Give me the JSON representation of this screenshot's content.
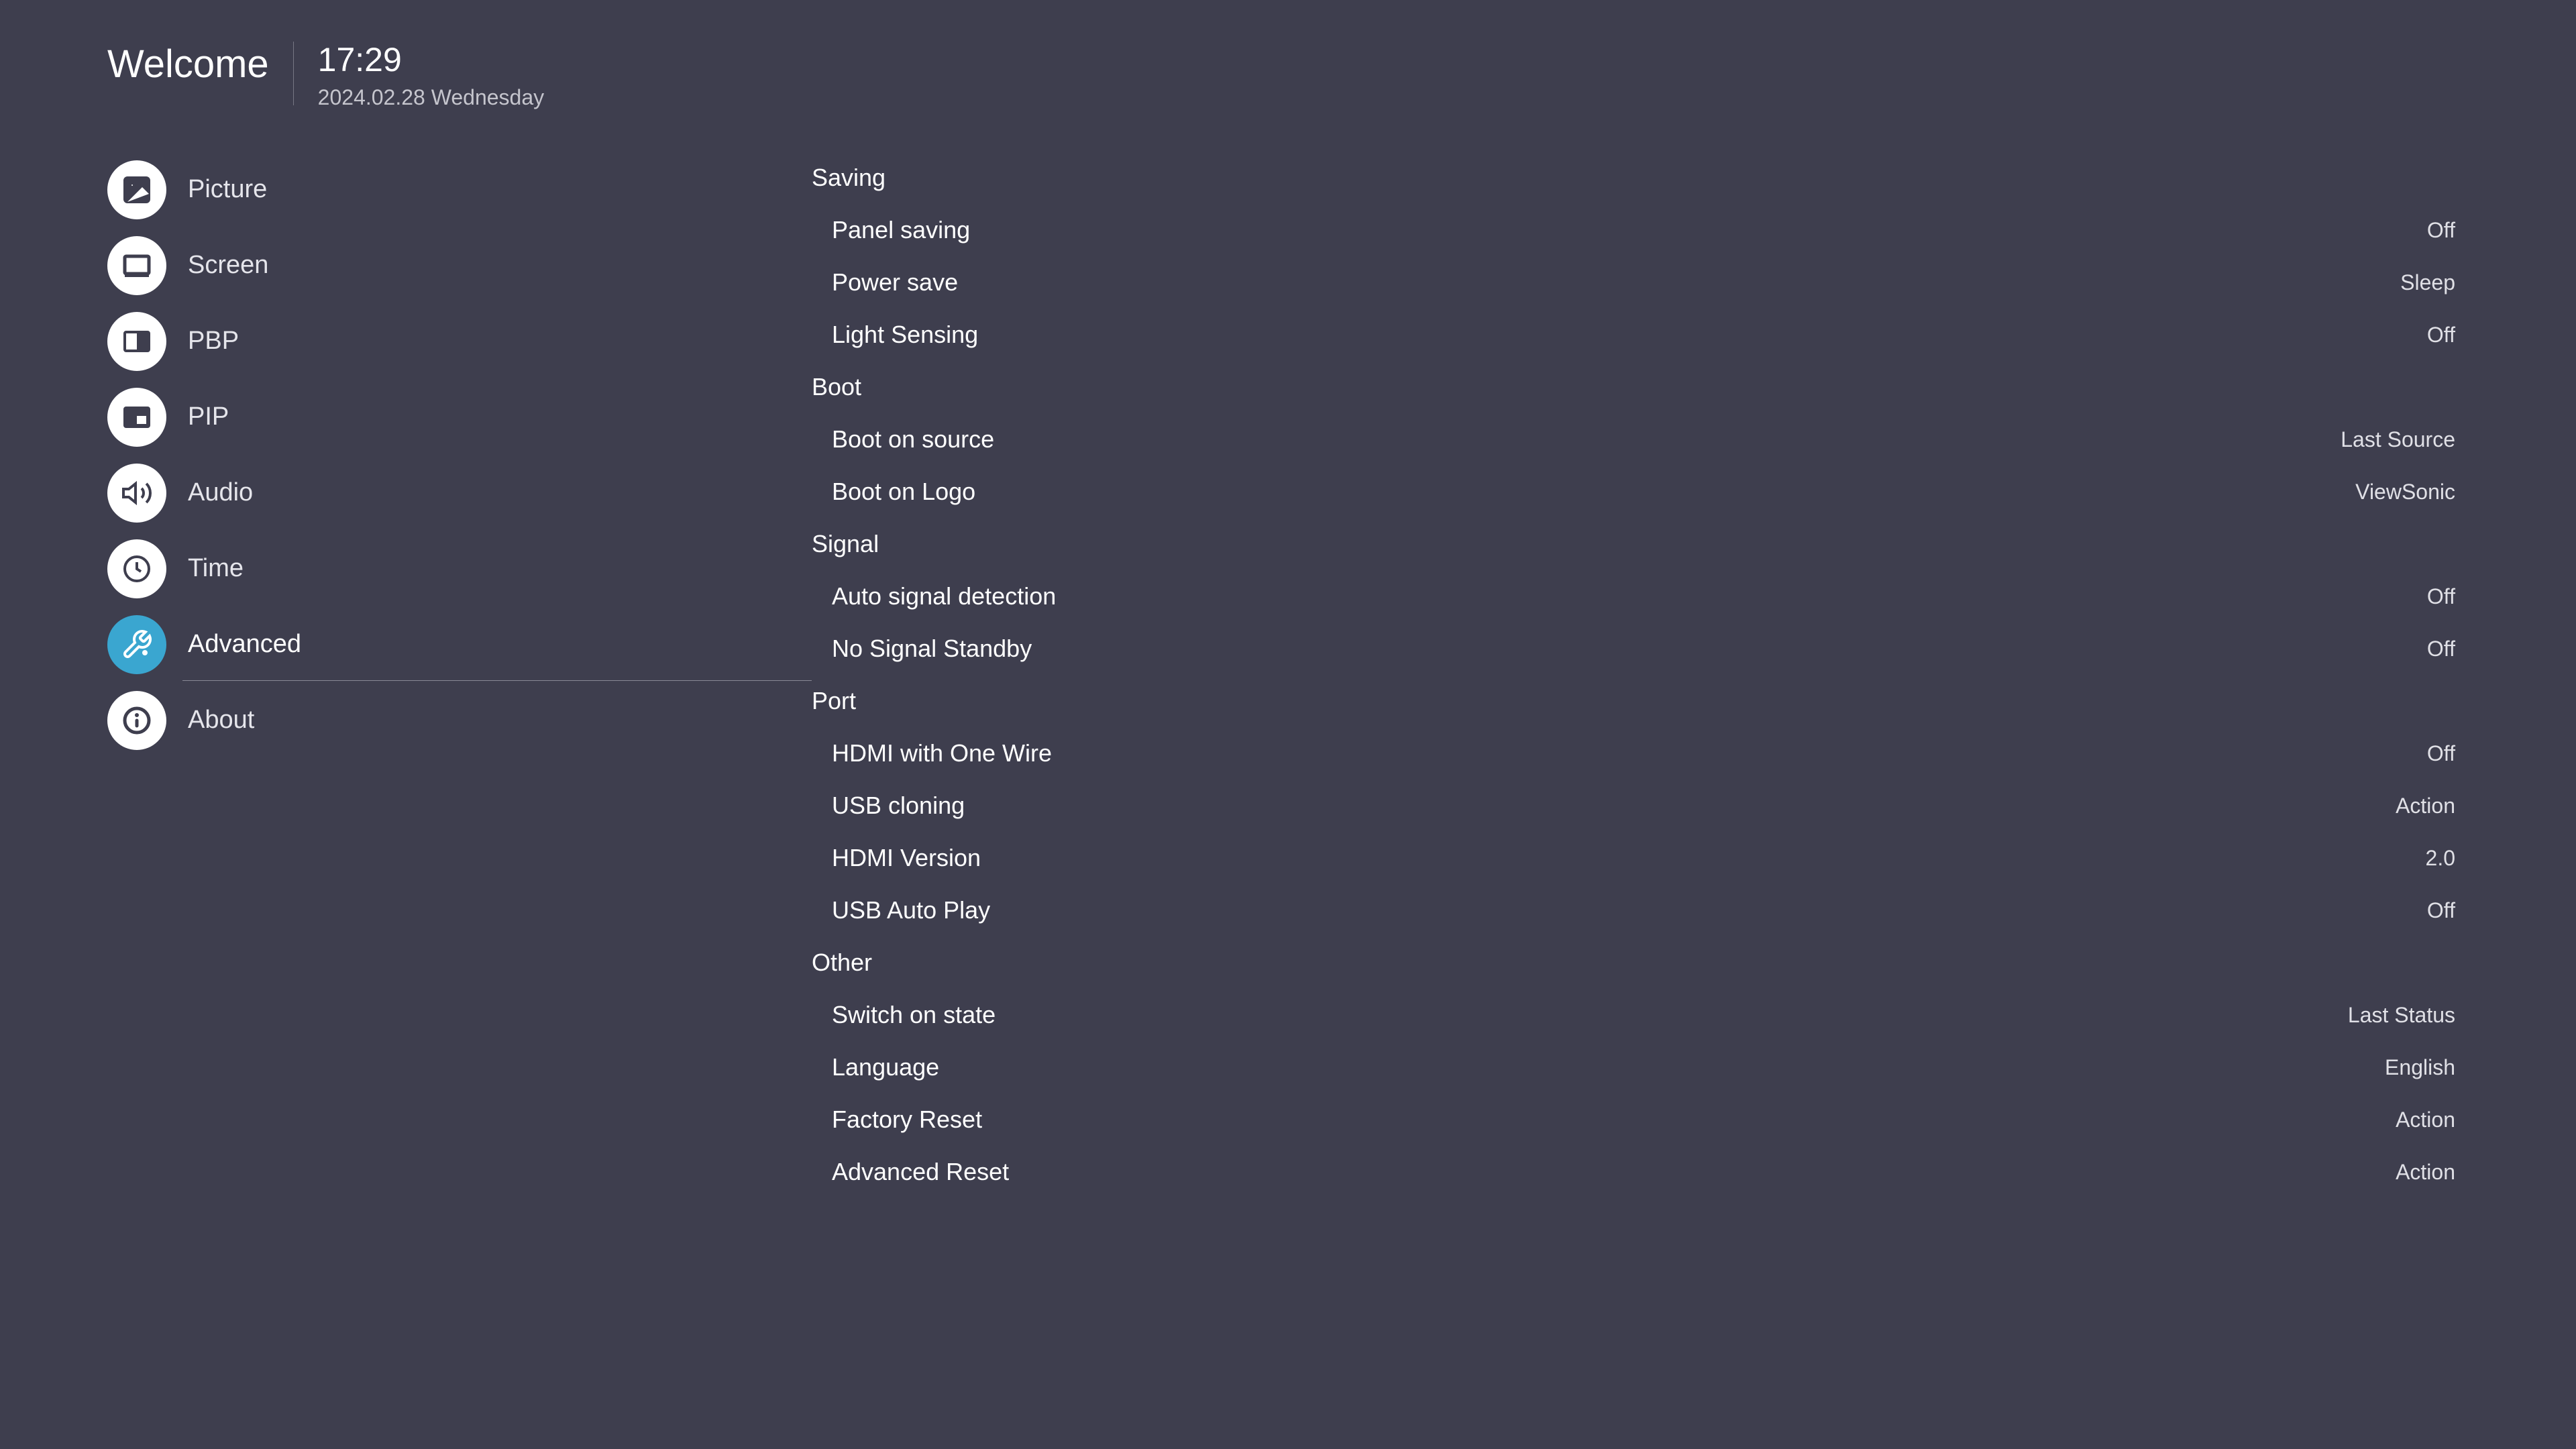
{
  "header": {
    "welcome": "Welcome",
    "time": "17:29",
    "date": "2024.02.28 Wednesday"
  },
  "sidebar": {
    "items": [
      {
        "id": "picture",
        "label": "Picture",
        "icon": "picture-icon"
      },
      {
        "id": "screen",
        "label": "Screen",
        "icon": "screen-icon"
      },
      {
        "id": "pbp",
        "label": "PBP",
        "icon": "pbp-icon"
      },
      {
        "id": "pip",
        "label": "PIP",
        "icon": "pip-icon"
      },
      {
        "id": "audio",
        "label": "Audio",
        "icon": "audio-icon"
      },
      {
        "id": "time",
        "label": "Time",
        "icon": "time-icon"
      },
      {
        "id": "advanced",
        "label": "Advanced",
        "icon": "advanced-icon"
      },
      {
        "id": "about",
        "label": "About",
        "icon": "about-icon"
      }
    ],
    "active": "advanced"
  },
  "content": {
    "sections": [
      {
        "title": "Saving",
        "items": [
          {
            "label": "Panel saving",
            "value": "Off"
          },
          {
            "label": "Power save",
            "value": "Sleep"
          },
          {
            "label": "Light Sensing",
            "value": "Off"
          }
        ]
      },
      {
        "title": "Boot",
        "items": [
          {
            "label": "Boot on source",
            "value": "Last Source"
          },
          {
            "label": "Boot on Logo",
            "value": "ViewSonic"
          }
        ]
      },
      {
        "title": "Signal",
        "items": [
          {
            "label": "Auto signal detection",
            "value": "Off"
          },
          {
            "label": "No Signal Standby",
            "value": "Off"
          }
        ]
      },
      {
        "title": "Port",
        "items": [
          {
            "label": "HDMI with One Wire",
            "value": "Off"
          },
          {
            "label": "USB cloning",
            "value": "Action"
          },
          {
            "label": "HDMI Version",
            "value": "2.0"
          },
          {
            "label": "USB Auto Play",
            "value": "Off"
          }
        ]
      },
      {
        "title": "Other",
        "items": [
          {
            "label": "Switch on state",
            "value": "Last Status"
          },
          {
            "label": "Language",
            "value": "English"
          },
          {
            "label": "Factory Reset",
            "value": "Action"
          },
          {
            "label": "Advanced Reset",
            "value": "Action"
          }
        ]
      }
    ]
  }
}
